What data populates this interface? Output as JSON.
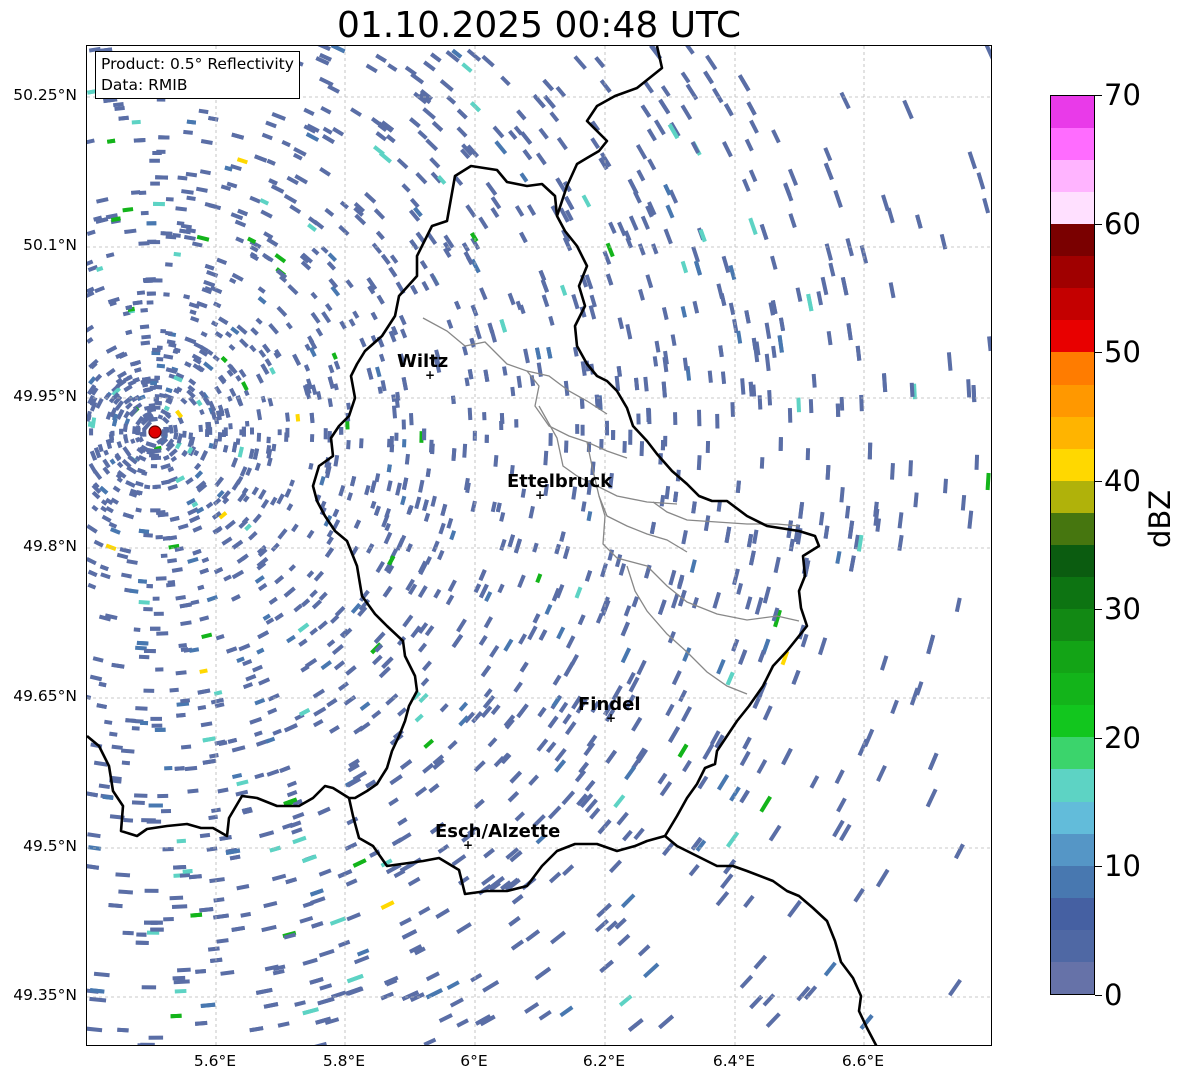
{
  "title": "01.10.2025 00:48 UTC",
  "info": {
    "product": "Product: 0.5° Reflectivity",
    "data": "Data: RMIB"
  },
  "lat_labels": [
    "50.25°N",
    "50.1°N",
    "49.95°N",
    "49.8°N",
    "49.65°N",
    "49.5°N",
    "49.35°N"
  ],
  "lon_labels": [
    "5.6°E",
    "5.8°E",
    "6°E",
    "6.2°E",
    "6.4°E",
    "6.6°E"
  ],
  "cities": [
    "Wiltz",
    "Ettelbruck",
    "Findel",
    "Esch/Alzette"
  ],
  "radar_site_color": "#e00000",
  "colorbar": {
    "unit": "dBZ",
    "tick_labels": [
      "0",
      "10",
      "20",
      "30",
      "40",
      "50",
      "60",
      "70"
    ],
    "colors": [
      "#6672a8",
      "#4f68a4",
      "#4560a2",
      "#4878b0",
      "#5596c6",
      "#62bcda",
      "#5dd3c4",
      "#3bd46c",
      "#12c61e",
      "#13b41a",
      "#13a416",
      "#128914",
      "#0d7412",
      "#0b5c10",
      "#46760f",
      "#b0b20a",
      "#ffd800",
      "#ffb400",
      "#ff9800",
      "#ff7c00",
      "#e80000",
      "#c40000",
      "#a00000",
      "#7a0000",
      "#ffe0ff",
      "#ffb4ff",
      "#ff6cff",
      "#e93ae9"
    ]
  }
}
